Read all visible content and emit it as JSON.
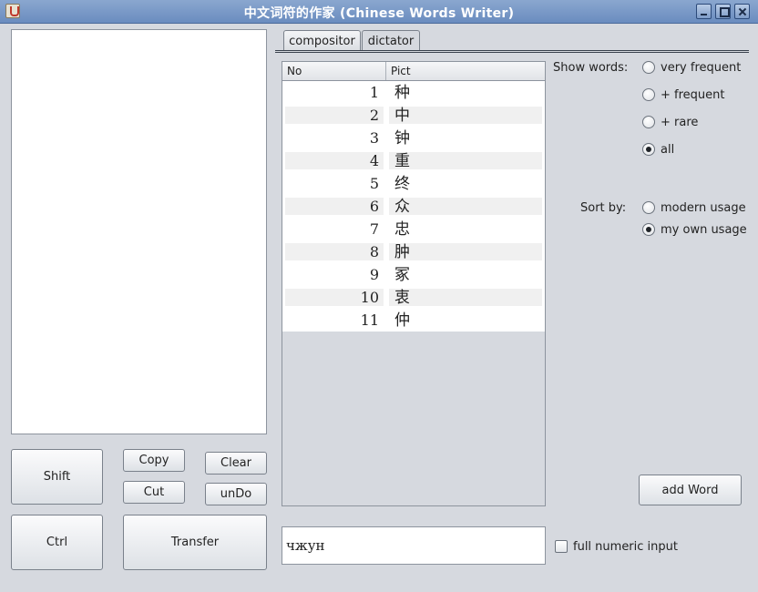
{
  "window": {
    "title": "中文词符的作家 (Chinese Words Writer)"
  },
  "keys": {
    "shift": "Shift",
    "ctrl": "Ctrl",
    "copy": "Copy",
    "cut": "Cut",
    "clear": "Clear",
    "undo": "unDo",
    "transfer": "Transfer"
  },
  "tabs": [
    {
      "label": "compositor",
      "active": false
    },
    {
      "label": "dictator",
      "active": true
    }
  ],
  "table": {
    "headers": {
      "no": "No",
      "pict": "Pict"
    },
    "rows": [
      {
        "no": "1",
        "pict": "种"
      },
      {
        "no": "2",
        "pict": "中"
      },
      {
        "no": "3",
        "pict": "钟"
      },
      {
        "no": "4",
        "pict": "重"
      },
      {
        "no": "5",
        "pict": "终"
      },
      {
        "no": "6",
        "pict": "众"
      },
      {
        "no": "7",
        "pict": "忠"
      },
      {
        "no": "8",
        "pict": "肿"
      },
      {
        "no": "9",
        "pict": "冢"
      },
      {
        "no": "10",
        "pict": "衷"
      },
      {
        "no": "11",
        "pict": "仲"
      }
    ]
  },
  "show_words": {
    "label": "Show words:",
    "options": [
      {
        "label": "very frequent",
        "selected": false
      },
      {
        "label": "+ frequent",
        "selected": false
      },
      {
        "label": "+ rare",
        "selected": false
      },
      {
        "label": "all",
        "selected": true
      }
    ]
  },
  "sort_by": {
    "label": "Sort by:",
    "options": [
      {
        "label": "modern usage",
        "selected": false
      },
      {
        "label": "my own usage",
        "selected": true
      }
    ]
  },
  "add_word": "add Word",
  "input": {
    "value": "чжун"
  },
  "full_numeric": {
    "label": "full numeric input",
    "checked": false
  }
}
